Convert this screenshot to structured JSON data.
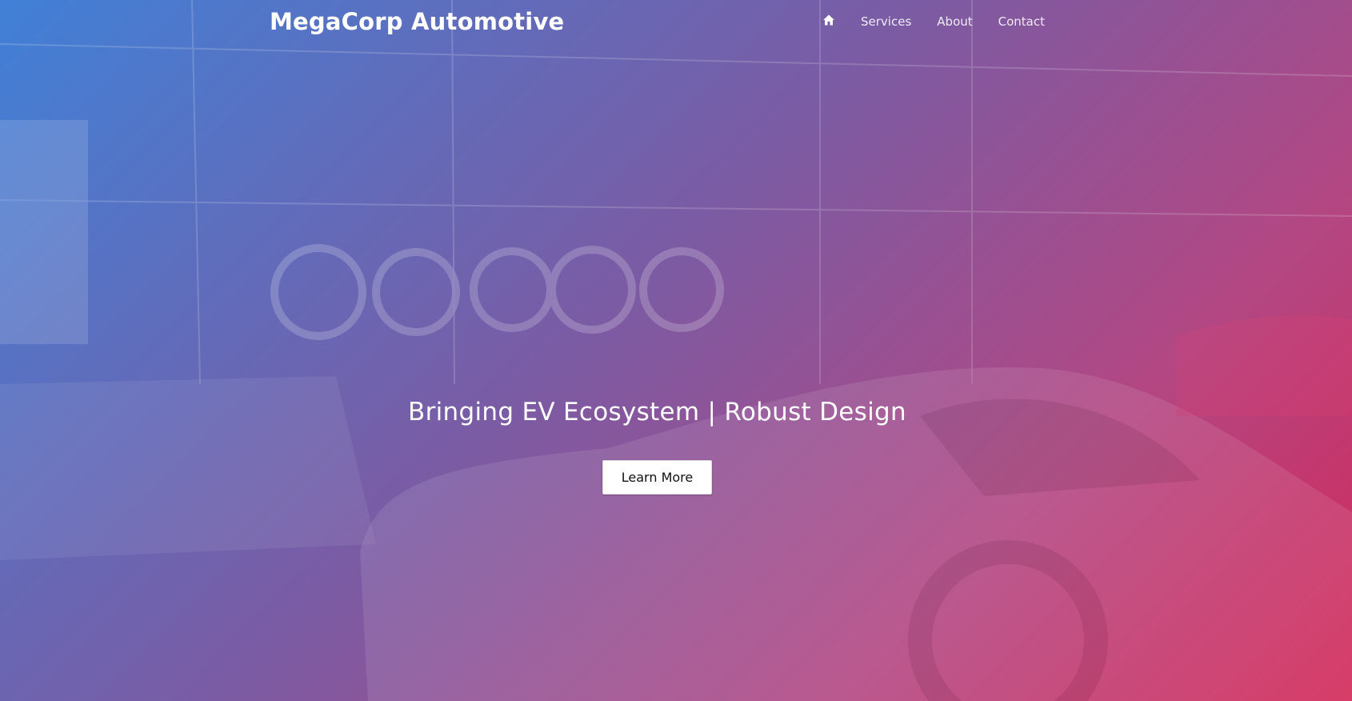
{
  "navbar": {
    "brand": "MegaCorp Automotive",
    "home_icon": "home-icon",
    "links": [
      "Services",
      "About",
      "Contact"
    ]
  },
  "hero": {
    "tagline": "Bringing EV Ecosystem | Robust Design",
    "cta_label": "Learn More"
  },
  "colors": {
    "gradient_start": "#3A80DE",
    "gradient_mid": "#8A4FA6",
    "gradient_end": "#D72355",
    "text": "#FFFFFF",
    "button_bg": "#FFFFFF"
  }
}
